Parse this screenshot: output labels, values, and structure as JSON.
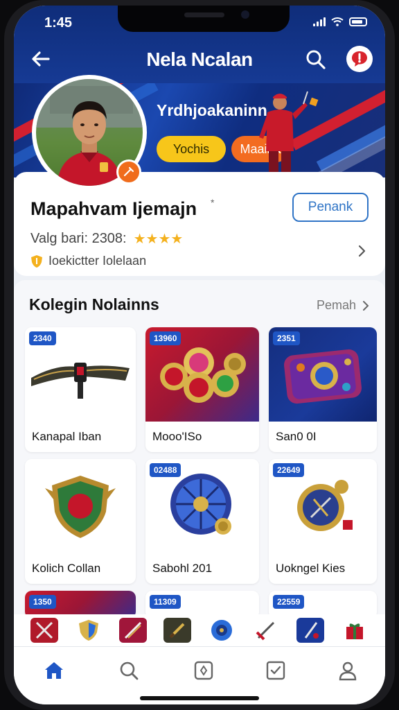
{
  "status_bar": {
    "time": "1:45"
  },
  "header": {
    "title": "Nela Ncalan"
  },
  "icons": {
    "back": "arrow-left-icon",
    "search": "search-icon",
    "alert": "speech-bubble-alert-icon",
    "edit": "edit-icon",
    "chevron": "chevron-right-icon"
  },
  "banner": {
    "heading": "Yrdhjoakaninn",
    "pill_primary": "Yochis",
    "pill_secondary": "Maaina"
  },
  "profile": {
    "name": "Mapahvam Ijemajn",
    "name_mark": "*",
    "follow_label": "Penank",
    "meta_label": "Valg bari: 2308:",
    "rating_stars": "★★★★",
    "rating_value": 4,
    "sub_label": "Ioekictter Iolelaan"
  },
  "collection": {
    "title": "Kolegin Nolainns",
    "see_all": "Pemah",
    "items": [
      {
        "price": "2340",
        "label": "Kanapal Iban",
        "bg": "white"
      },
      {
        "price": "13960",
        "label": "Mooo'ISo",
        "bg": "red"
      },
      {
        "price": "2351",
        "label": "San0 0I",
        "bg": "navy"
      },
      {
        "price": "",
        "label": "Kolich Collan",
        "bg": "white"
      },
      {
        "price": "02488",
        "label": "Sabohl 201",
        "bg": "white"
      },
      {
        "price": "22649",
        "label": "Uokngel Kies",
        "bg": "white"
      },
      {
        "price": "1350",
        "label": "",
        "bg": "red"
      },
      {
        "price": "11309",
        "label": "",
        "bg": "white"
      },
      {
        "price": "22559",
        "label": "",
        "bg": "white"
      }
    ]
  },
  "quick_icons": [
    "crossed-swords-icon",
    "shield-icon",
    "blades-icon",
    "dagger-icon",
    "orb-icon",
    "sword-icon",
    "lightning-icon",
    "gift-icon"
  ],
  "tabbar": [
    "home-icon",
    "search-icon",
    "inventory-icon",
    "checklist-icon",
    "profile-icon"
  ],
  "colors": {
    "header_navy": "#0f2d7a",
    "accent_blue": "#1f56c5",
    "accent_orange": "#f36c20",
    "accent_yellow": "#f7c61a",
    "star_gold": "#f4b11e"
  }
}
